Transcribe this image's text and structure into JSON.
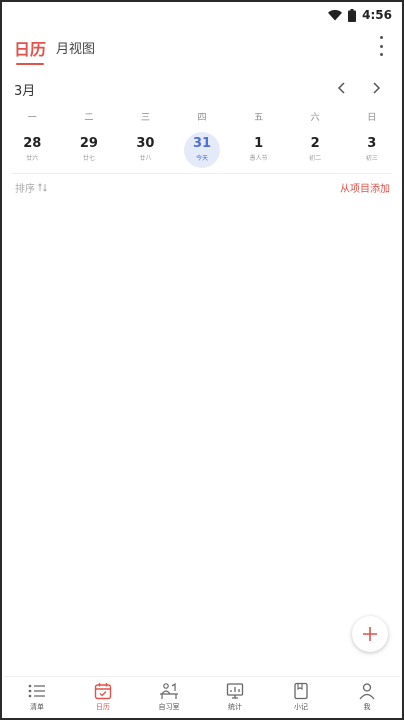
{
  "status_bar": {
    "time": "4:56"
  },
  "header": {
    "tab_day": "日历",
    "tab_month": "月视图"
  },
  "month_row": {
    "month": "3月"
  },
  "weekdays": [
    "一",
    "二",
    "三",
    "四",
    "五",
    "六",
    "日"
  ],
  "dates": [
    {
      "num": "28",
      "sub": "廿六"
    },
    {
      "num": "29",
      "sub": "廿七"
    },
    {
      "num": "30",
      "sub": "廿八"
    },
    {
      "num": "31",
      "sub": "今天"
    },
    {
      "num": "1",
      "sub": "愚人节"
    },
    {
      "num": "2",
      "sub": "初二"
    },
    {
      "num": "3",
      "sub": "初三"
    }
  ],
  "sort_row": {
    "sort_label": "排序",
    "add_label": "从项目添加"
  },
  "bottom_nav": [
    {
      "label": "清单",
      "icon": "list-icon"
    },
    {
      "label": "日历",
      "icon": "calendar-icon"
    },
    {
      "label": "自习室",
      "icon": "study-room-icon"
    },
    {
      "label": "统计",
      "icon": "stats-icon"
    },
    {
      "label": "小记",
      "icon": "note-icon"
    },
    {
      "label": "我",
      "icon": "profile-icon"
    }
  ],
  "colors": {
    "accent": "#e0524a",
    "today_bg": "#e4eaf8",
    "today_text": "#4f6fd1"
  }
}
